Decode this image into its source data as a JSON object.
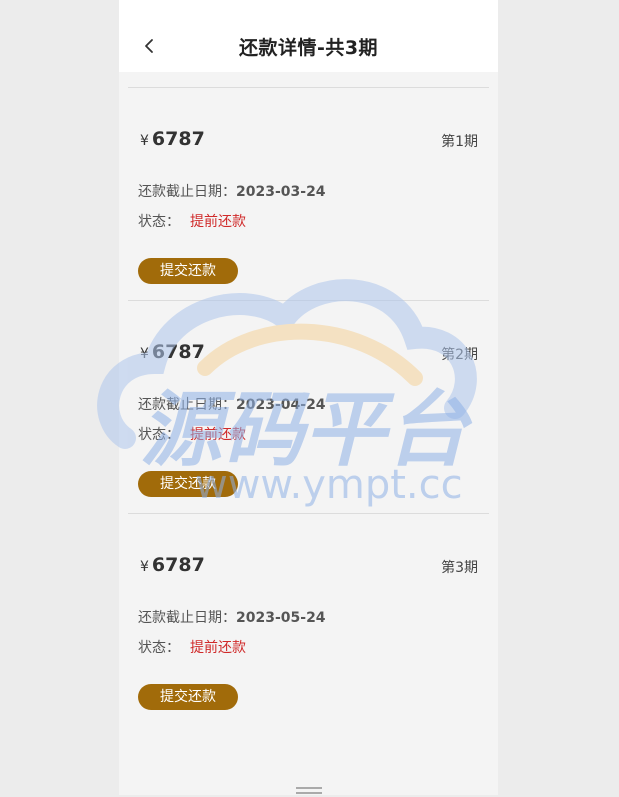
{
  "header": {
    "title": "还款详情-共3期"
  },
  "installments": [
    {
      "currency": "¥",
      "amount": "6787",
      "period": "第1期",
      "due_label": "还款截止日期：",
      "due_date": "2023-03-24",
      "status_label": "状态：",
      "status": "提前还款",
      "submit_label": "提交还款"
    },
    {
      "currency": "¥",
      "amount": "6787",
      "period": "第2期",
      "due_label": "还款截止日期：",
      "due_date": "2023-04-24",
      "status_label": "状态：",
      "status": "提前还款",
      "submit_label": "提交还款"
    },
    {
      "currency": "¥",
      "amount": "6787",
      "period": "第3期",
      "due_label": "还款截止日期：",
      "due_date": "2023-05-24",
      "status_label": "状态：",
      "status": "提前还款",
      "submit_label": "提交还款"
    }
  ],
  "watermark": {
    "text": "源码平台",
    "url": "www.ympt.cc"
  },
  "colors": {
    "accent": "#a16b0a",
    "status": "#d02a2a",
    "background": "#f4f4f4"
  }
}
